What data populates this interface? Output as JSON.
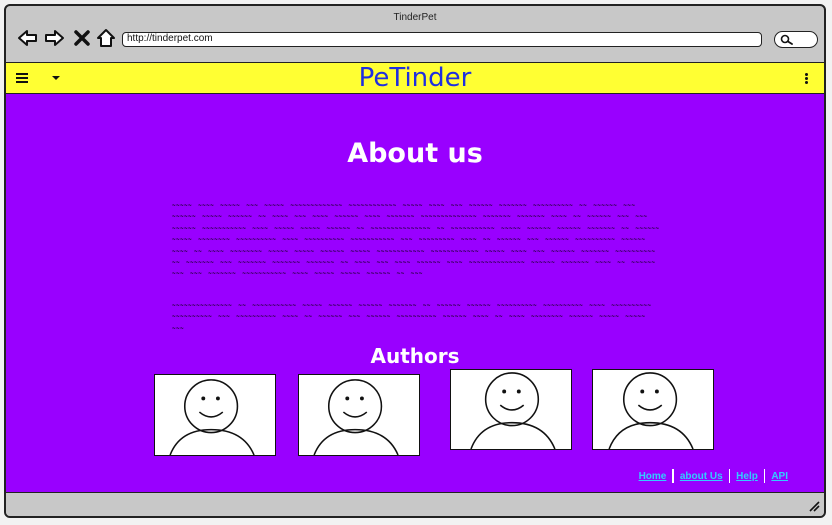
{
  "window": {
    "title": "TinderPet"
  },
  "browser": {
    "url": "http://tinderpet.com",
    "icons": [
      "back-icon",
      "forward-icon",
      "close-icon",
      "home-icon",
      "search-icon"
    ]
  },
  "app": {
    "title": "PeTinder"
  },
  "about": {
    "heading": "About us",
    "paragraph1": "~~~~~ ~~~~ ~~~~~ ~~~ ~~~~~ ~~~~~~~~~~~~~ ~~~~~~~~~~~~ ~~~~~ ~~~~ ~~~ ~~~~~~ ~~~~~~~ ~~~~~~~~~~ ~~ ~~~~~~ ~~~ ~~~~~~ ~~~~~ ~~~~~~ ~~ ~~~~ ~~~ ~~~~ ~~~~~~ ~~~~ ~~~~~~~ ~~~~~~~~~~~~~~ ~~~~~~~ ~~~~~~~ ~~~~ ~~ ~~~~~~ ~~~ ~~~ ~~~~~~ ~~~~~~~~~~~ ~~~~ ~~~~~ ~~~~~ ~~~~~~ ~~ ~~~~~~~~~~~~~~~ ~~ ~~~~~~~~~~~ ~~~~~ ~~~~~~ ~~~~~~ ~~~~~~~ ~~ ~~~~~~ ~~~~~ ~~~~~~~~ ~~~~~~~~~~ ~~~~ ~~~~~~~~~~ ~~~~~~~~~~~ ~~~ ~~~~~~~~~ ~~~~ ~~ ~~~~~~ ~~~ ~~~~~~ ~~~~~~~~~~ ~~~~~~ ~~~~ ~~ ~~~~ ~~~~~~~~ ~~~~~ ~~~~~ ~~~~~~ ~~~~~ ~~~~~~~~~~~~ ~~~~~~~~~~~~ ~~~~~ ~~~~ ~~~ ~~~~~~ ~~~~~~~ ~~~~~~~~~~ ~~ ~~~~~~~ ~~~ ~~~~~~~ ~~~~~~~ ~~~~~~~ ~~ ~~~~ ~~~ ~~~~ ~~~~~~ ~~~~ ~~~~~~~~~~~~~~ ~~~~~~ ~~~~~~~ ~~~~ ~~ ~~~~~~ ~~~ ~~~ ~~~~~~~ ~~~~~~~~~~~ ~~~~ ~~~~~ ~~~~~ ~~~~~~ ~~ ~~~",
    "paragraph2": "~~~~~~~~~~~~~~~ ~~ ~~~~~~~~~~~ ~~~~~ ~~~~~~ ~~~~~~ ~~~~~~~ ~~ ~~~~~~ ~~~~~~ ~~~~~~~~~~ ~~~~~~~~~~ ~~~~ ~~~~~~~~~~ ~~~~~~~~~~ ~~~ ~~~~~~~~~~ ~~~~ ~~ ~~~~~~ ~~~ ~~~~~~ ~~~~~~~~~~ ~~~~~~ ~~~~ ~~ ~~~~ ~~~~~~~~ ~~~~~~ ~~~~~ ~~~~~ ~~~"
  },
  "authors": {
    "heading": "Authors",
    "items": [
      {
        "icon": "author-avatar-icon"
      },
      {
        "icon": "author-avatar-icon"
      },
      {
        "icon": "author-avatar-icon"
      },
      {
        "icon": "author-avatar-icon"
      }
    ]
  },
  "footer": {
    "links": [
      {
        "label": "Home"
      },
      {
        "label": "about Us"
      },
      {
        "label": "Help"
      },
      {
        "label": "API"
      }
    ]
  },
  "colors": {
    "appbar": "#ffff33",
    "title": "#1f2fe0",
    "main_background": "#9900ff",
    "link": "#33ccff"
  }
}
